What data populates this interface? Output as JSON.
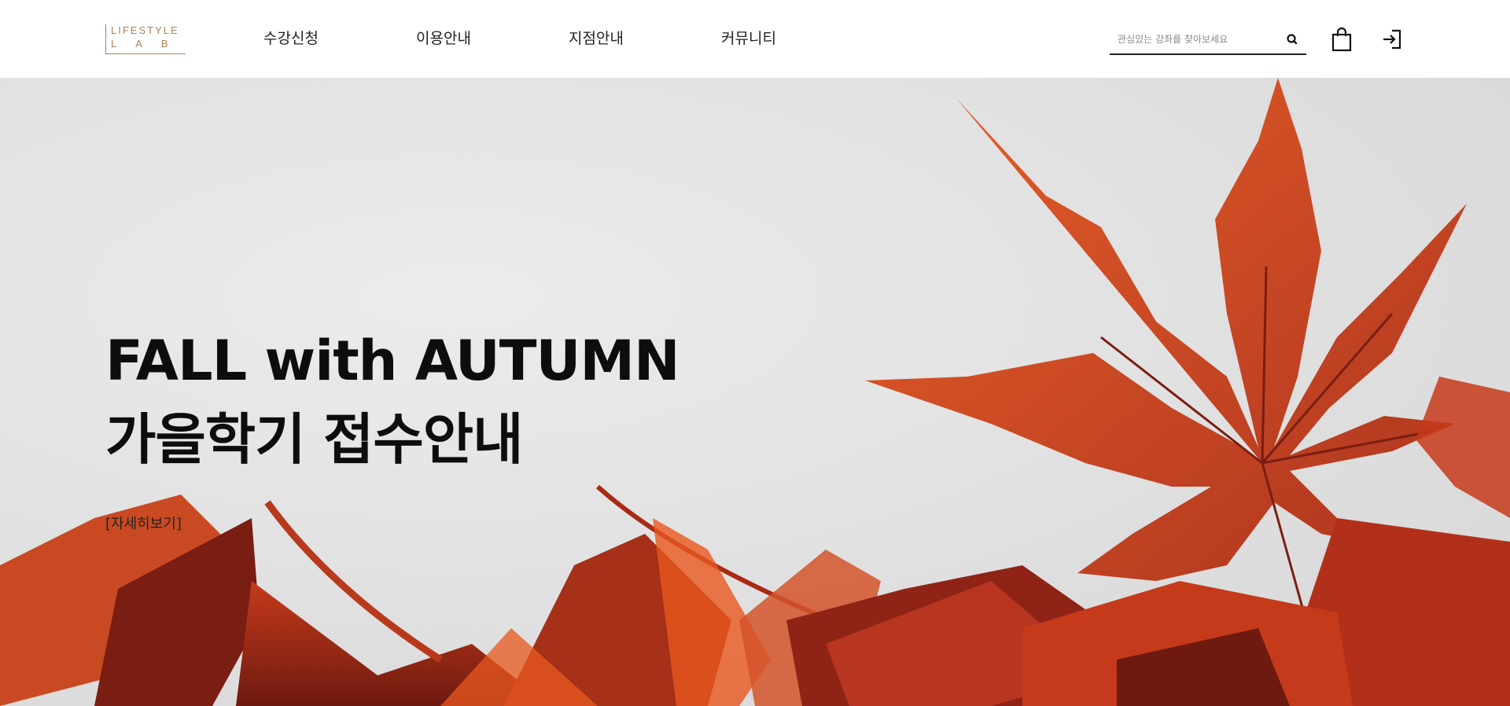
{
  "logo": {
    "line1": "LIFESTYLE",
    "line2": "LAB"
  },
  "nav": {
    "items": [
      {
        "label": "수강신청"
      },
      {
        "label": "이용안내"
      },
      {
        "label": "지점안내"
      },
      {
        "label": "커뮤니티"
      }
    ]
  },
  "search": {
    "placeholder": "관심있는 강좌를 찾아보세요",
    "icon": "search-icon"
  },
  "icons": {
    "cart": "shopping-bag-icon",
    "login": "login-icon"
  },
  "hero": {
    "title_line1": "FALL with AUTUMN",
    "title_line2": "가을학기 접수안내",
    "more_link": "[자세히보기]",
    "colors": {
      "leaf_dark": "#7a1d12",
      "leaf_mid": "#c53a1a",
      "leaf_bright": "#e8581f",
      "background": "#e4e4e4"
    }
  },
  "colors": {
    "brand": "#a9825a",
    "text": "#111111"
  }
}
